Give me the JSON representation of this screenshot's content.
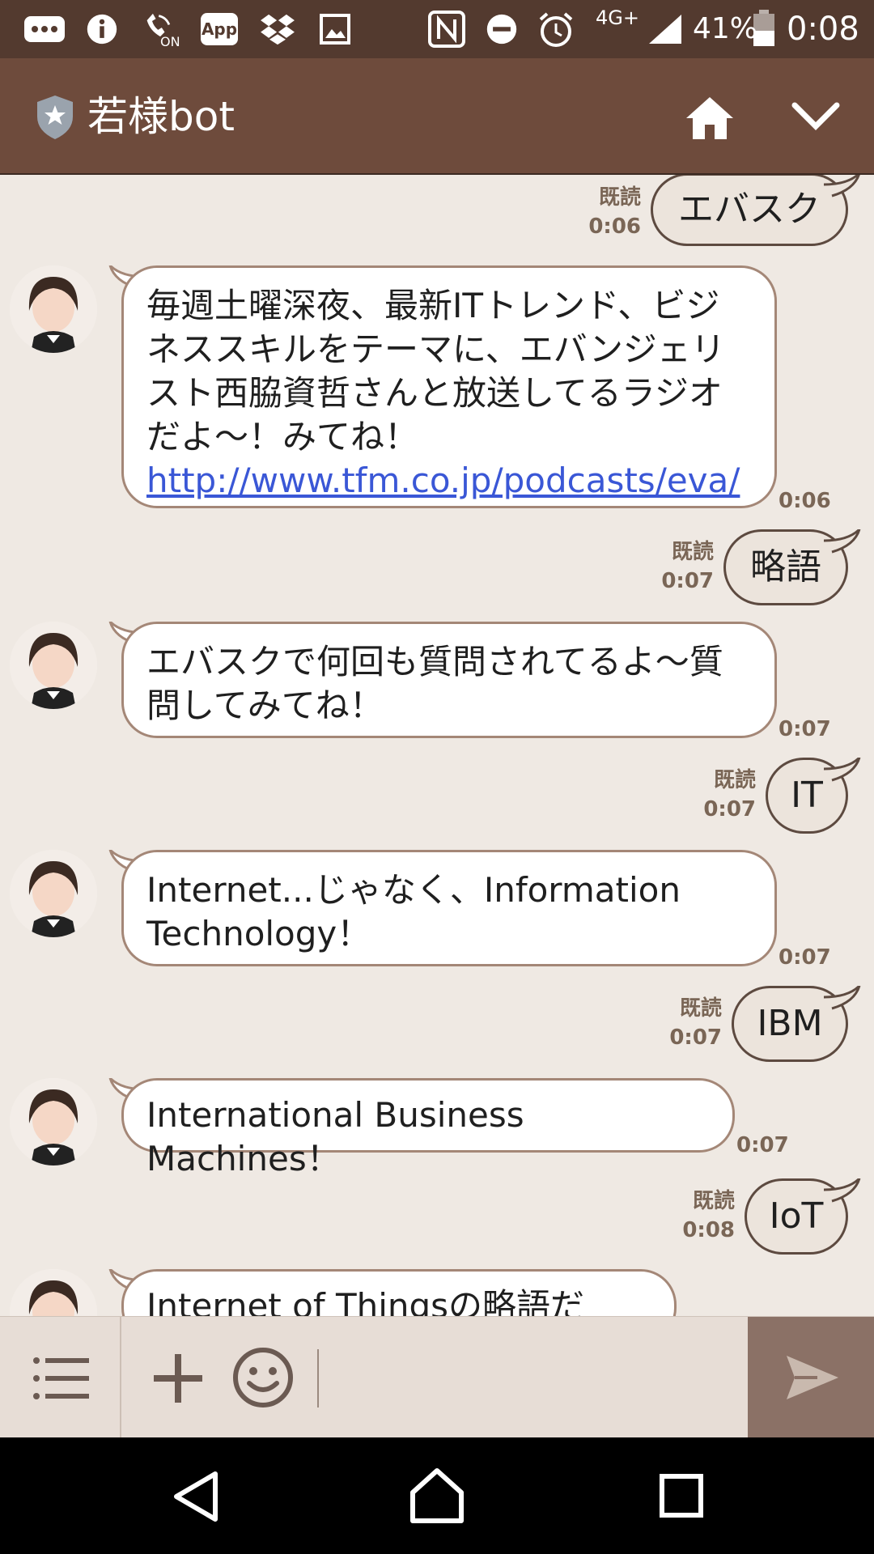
{
  "status_bar": {
    "network": "4G+",
    "battery": "41%",
    "time": "0:08",
    "wifi_call_label": "ON",
    "app_badge": "App"
  },
  "header": {
    "title": "若様bot"
  },
  "messages": [
    {
      "id": "m1",
      "from": "me",
      "text": "エバスク",
      "read": "既読",
      "time": "0:06"
    },
    {
      "id": "m2",
      "from": "bot",
      "text_before": "毎週土曜深夜、最新ITトレンド、ビジネススキルをテーマに、エバンジェリスト西脇資哲さんと放送してるラジオだよ～！みてね！ ",
      "link": "http://www.tfm.co.jp/podcasts/eva/",
      "time": "0:06"
    },
    {
      "id": "m3",
      "from": "me",
      "text": "略語",
      "read": "既読",
      "time": "0:07"
    },
    {
      "id": "m4",
      "from": "bot",
      "text": "エバスクで何回も質問されてるよ～質問してみてね！",
      "time": "0:07"
    },
    {
      "id": "m5",
      "from": "me",
      "text": "IT",
      "read": "既読",
      "time": "0:07"
    },
    {
      "id": "m6",
      "from": "bot",
      "text": "Internet...じゃなく、Information Technology！",
      "time": "0:07"
    },
    {
      "id": "m7",
      "from": "me",
      "text": "IBM",
      "read": "既読",
      "time": "0:07"
    },
    {
      "id": "m8",
      "from": "bot",
      "text": "International Business Machines！",
      "time": "0:07"
    },
    {
      "id": "m9",
      "from": "me",
      "text": "IoT",
      "read": "既読",
      "time": "0:08"
    },
    {
      "id": "m10",
      "from": "bot",
      "text": "Internet of Thingsの略語だね！"
    }
  ],
  "input": {
    "placeholder": ""
  },
  "colors": {
    "status_bar": "#533a2f",
    "header": "#6e4b3c",
    "chat_bg": "#efe9e3",
    "incoming_border": "#a48777",
    "outgoing_bg": "#ece4dc",
    "link": "#3a57d6",
    "send_button": "#8b7166"
  },
  "icons": [
    "notification-icon",
    "info-icon",
    "wifi-calling-icon",
    "app-icon",
    "dropbox-icon",
    "image-icon",
    "nfc-icon",
    "do-not-disturb-icon",
    "alarm-icon",
    "signal-icon",
    "battery-icon",
    "shield-star-icon",
    "home-icon",
    "chevron-down-icon",
    "menu-list-icon",
    "plus-icon",
    "smiley-icon",
    "send-icon",
    "back-icon",
    "home-nav-icon",
    "recents-icon"
  ]
}
